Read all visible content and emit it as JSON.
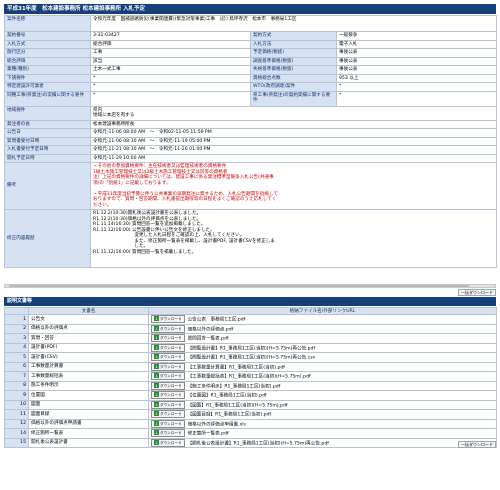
{
  "page_title": "平成31年度　松本建設事務所 松本建設事務所 入札予定",
  "details": {
    "rows": [
      {
        "l1": "案件名称",
        "v1": "令和元年度　国補道路防災(事業関連費)(緊急対策事業)工事　(診) 鳥坪寺沢　松本市　事務局1工区",
        "l2": "",
        "v2": ""
      },
      {
        "l1": "契約番号",
        "v1": "3-31-03427",
        "l2": "契約方式",
        "v2": "一般競争"
      },
      {
        "l1": "入札方式",
        "v1": "総合評価",
        "l2": "入札方法",
        "v2": "電子入札"
      },
      {
        "l1": "施行区分",
        "v1": "工事",
        "l2": "予定価格(税抜)",
        "v2": "事後公表"
      },
      {
        "l1": "総合評価",
        "v1": "該当",
        "l2": "調査基準価格(税抜)",
        "v2": "事後公表"
      },
      {
        "l1": "業種(種別)",
        "v1": "土木一式工事",
        "l2": "失格基準価格(税抜)",
        "v2": "事後公表"
      },
      {
        "l1": "下請要件",
        "v1": "*",
        "l2": "資格総合点数",
        "v2": "953 以上"
      },
      {
        "l1": "特定建設許可業者",
        "v1": "*",
        "l2": "WTO(政府調達)案件",
        "v2": "*"
      },
      {
        "l1": "同種工事(県発注)の実績に関する要件",
        "v1": "*",
        "l2": "県工事(県発注)の契約実績に関する要件",
        "v2": "*"
      },
      {
        "l1": "地域要件",
        "v1": "県内\n地域に本店を有する"
      },
      {
        "l1": "発注者の長",
        "v1": "松本建設事務所所長"
      },
      {
        "l1": "公告日",
        "v1": "令和元-11-06 08:00 AM　～　令和02-11-05 11:59 PM"
      },
      {
        "l1": "質問書受付日時",
        "v1": "令和元-11-06 08:30 AM　～　令和元-11-19 05:00 PM"
      },
      {
        "l1": "入札書受付予定日時",
        "v1": "令和元-11-21 08:30 AM　～　令和元-11-26 01:00 PM"
      },
      {
        "l1": "開札予定日時",
        "v1": "令和元-11-29 10:00 AM"
      }
    ],
    "notes_label": "備考",
    "notes_text": "・その他の参加資格要件：主任技術者又は監理技術者の資格要件\n1級土木施工管理技士又は2級土木施工管理技士又は同等の資格者\n注）上記の資格要件の詳細については、建設工事に係る発注標準型競争入札公告(共通事\n項)の「別紙1」に記載しております。\n\n・平成31年度当初予算に伴う公共事業の早期発注に資するため、入札公告期間を短縮して\nおりますので、質問・回答期間、入札書提出期限等の日程をよくご確認のうえ応札してく\nださい。",
    "history_label": "修正内容履歴",
    "history_text": "R1.12.2(10:30)開札後公表設計書を公表しました。\nR1.12.2(10:30)価格以外の評価点を公表しました。\nR1.11.14(16:30) 質問回答一覧を追加掲載しました。\nR1.11.12(16:00) 公告設書に伴い公告文を修正しました。\n　　　　　　　　　変更した入札日程をご確認の上、入札してください。\n　　　　　　　　　また、修正箇所一覧表を掲載し、設計書PDF, 設計書CSVを修正しま\n　　　　　　　　　した。\nR1.11.12(16:00) 質問回答一覧を掲載しました。"
  },
  "download_all_label": "一括ダウンロード",
  "attachments": {
    "section_title": "説明文書等",
    "col_name": "文書名",
    "col_file": "格納ファイル名/外部リンクURL",
    "dl_label": "ダウンロード",
    "items": [
      {
        "no": "1",
        "name": "公告文",
        "file": "公告公表　事務局1工区.pdf"
      },
      {
        "no": "2",
        "name": "価格以外の評価点",
        "file": "価格以外の評価点.pdf"
      },
      {
        "no": "3",
        "name": "質問・回答",
        "file": "質問回答一覧表.pdf"
      },
      {
        "no": "4",
        "name": "設計書(PDF)",
        "file": "【閲覧設計書】R1_事務局1工区(当初)(H=5.75m)再公告.pdf"
      },
      {
        "no": "5",
        "name": "設計書(CSV)",
        "file": "【閲覧設計書】R1_事務局1工区(当初)(H=5.75m)再公告.csv"
      },
      {
        "no": "6",
        "name": "工事数量計算書",
        "file": "【工事数量計算書】R1_事務局1工区(当初).pdf"
      },
      {
        "no": "7",
        "name": "工事数量総括表",
        "file": "【工事数量総括表】R1_事務局1工区(当初)(H=5.75m).pdf"
      },
      {
        "no": "8",
        "name": "施工条件明示",
        "file": "【施工条件明示】R1_事務局1工区(当初).pdf"
      },
      {
        "no": "9",
        "name": "位置図",
        "file": "【位置図】R1_事務局1工区(当初).pdf"
      },
      {
        "no": "10",
        "name": "図面",
        "file": "【図面】R1_事務局1工区(当初)(H=5.75m).pdf"
      },
      {
        "no": "11",
        "name": "図面目録",
        "file": "【図面目録】R1_事務局1工区(当初).pdf"
      },
      {
        "no": "12",
        "name": "価格以外の評価点申請書",
        "file": "価格以外の評価点申請書.xls"
      },
      {
        "no": "14",
        "name": "修正箇所一覧表",
        "file": "修正箇所一覧表.pdf"
      },
      {
        "no": "15",
        "name": "開札後公表設計書",
        "file": "【開札後公表設計書】R1_事務局1工区(当初)(H=5.75m)再公告.pdf"
      }
    ]
  }
}
